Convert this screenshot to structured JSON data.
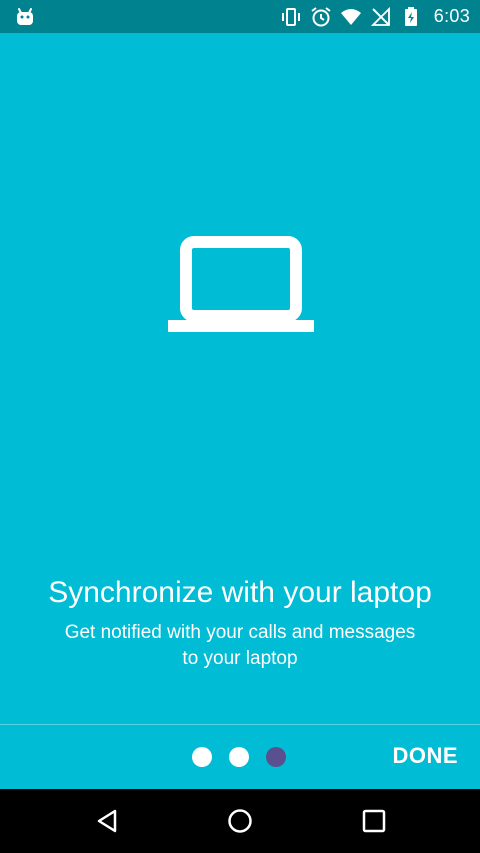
{
  "status_bar": {
    "time": "6:03",
    "left_icon": "android-icon",
    "right_icons": [
      "vibrate-icon",
      "alarm-icon",
      "wifi-icon",
      "no-signal-icon",
      "battery-charging-icon"
    ]
  },
  "colors": {
    "background": "#00bcd4",
    "status_bar": "#00838f",
    "active_dot": "#5a4f8f",
    "text": "#ffffff"
  },
  "illustration": {
    "icon": "laptop-icon"
  },
  "content": {
    "headline": "Synchronize with your laptop",
    "subtext_line1": "Get notified with your calls and messages",
    "subtext_line2": "to your laptop"
  },
  "pager": {
    "total_pages": 3,
    "current_page": 3
  },
  "bottom_bar": {
    "done_label": "DONE"
  },
  "nav_bar": {
    "buttons": [
      "back-icon",
      "home-icon",
      "recent-apps-icon"
    ]
  }
}
